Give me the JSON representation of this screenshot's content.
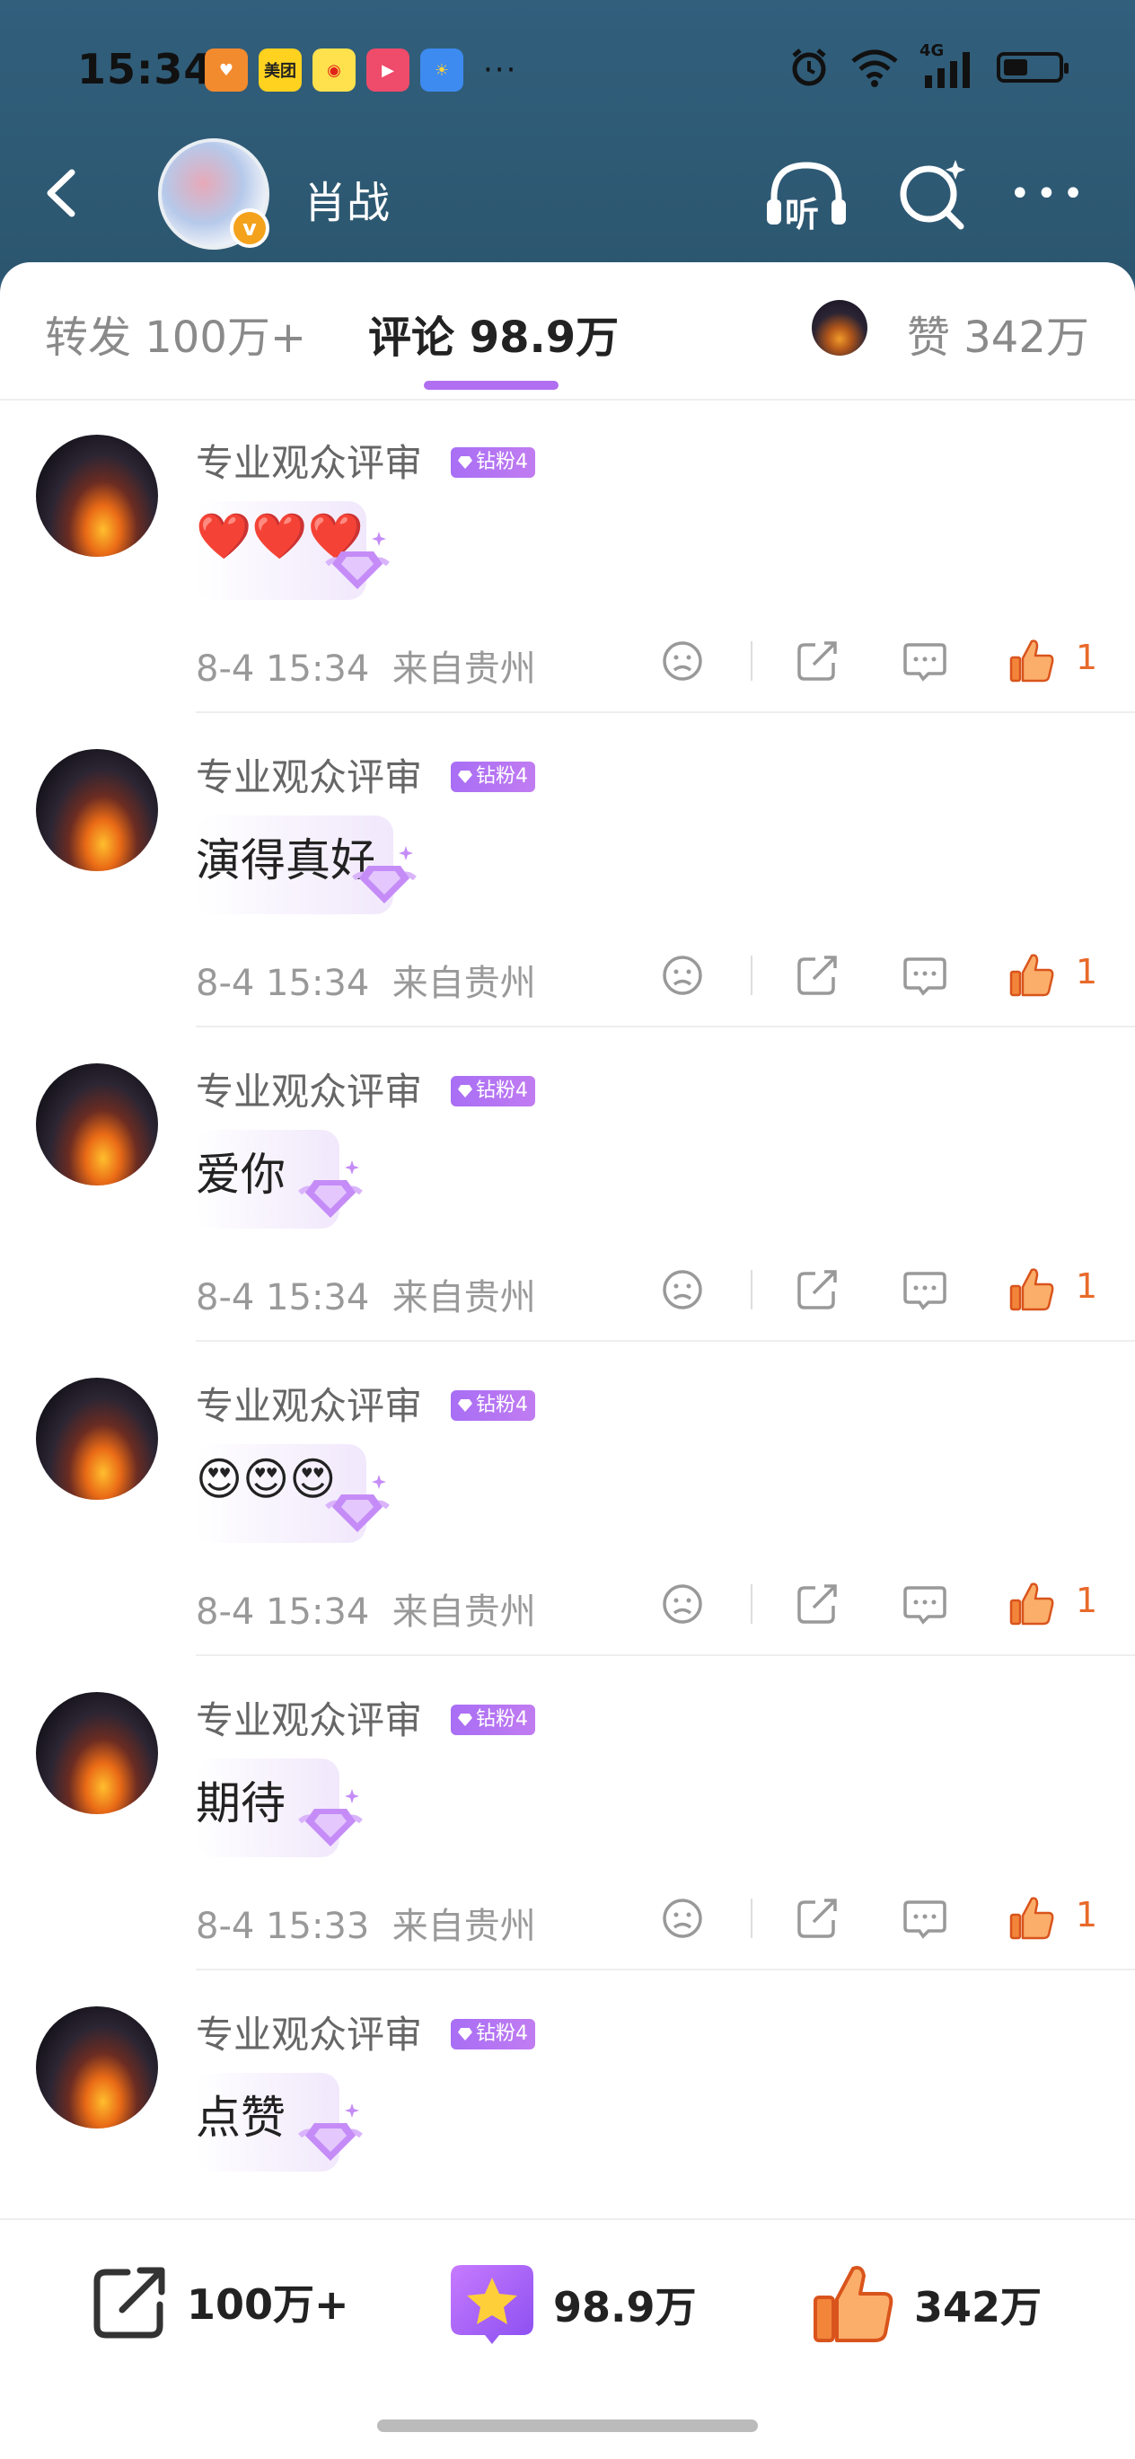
{
  "status_bar": {
    "time": "15:34",
    "app_icons": [
      "heart-app-icon",
      "meituan-icon",
      "weibo-icon",
      "video-icon",
      "weather-icon"
    ],
    "meituan_label": "美团",
    "more": "···",
    "network": "4G",
    "battery_level": 0.4
  },
  "nav": {
    "profile_name": "肖战",
    "listen_label": "听",
    "verified_mark": "v"
  },
  "tabs": {
    "repost": "转发 100万+",
    "comments": "评论 98.9万",
    "likes": "赞 342万"
  },
  "comments": [
    {
      "user": "专业观众评审",
      "badge": "钻粉4",
      "text": "❤️❤️❤️",
      "time": "8-4 15:34",
      "location": "来自贵州",
      "likes": "1"
    },
    {
      "user": "专业观众评审",
      "badge": "钻粉4",
      "text": "演得真好",
      "time": "8-4 15:34",
      "location": "来自贵州",
      "likes": "1"
    },
    {
      "user": "专业观众评审",
      "badge": "钻粉4",
      "text": "爱你",
      "time": "8-4 15:34",
      "location": "来自贵州",
      "likes": "1"
    },
    {
      "user": "专业观众评审",
      "badge": "钻粉4",
      "text": "😍😍😍",
      "time": "8-4 15:34",
      "location": "来自贵州",
      "likes": "1"
    },
    {
      "user": "专业观众评审",
      "badge": "钻粉4",
      "text": "期待",
      "time": "8-4 15:33",
      "location": "来自贵州",
      "likes": "1"
    },
    {
      "user": "专业观众评审",
      "badge": "钻粉4",
      "text": "点赞",
      "time": "",
      "location": "",
      "likes": ""
    }
  ],
  "bottom_bar": {
    "repost_count": "100万+",
    "comment_count": "98.9万",
    "like_count": "342万"
  },
  "colors": {
    "header_bg": "#2f5a78",
    "accent_purple": "#b06ef0",
    "like_orange": "#e86a2a"
  }
}
